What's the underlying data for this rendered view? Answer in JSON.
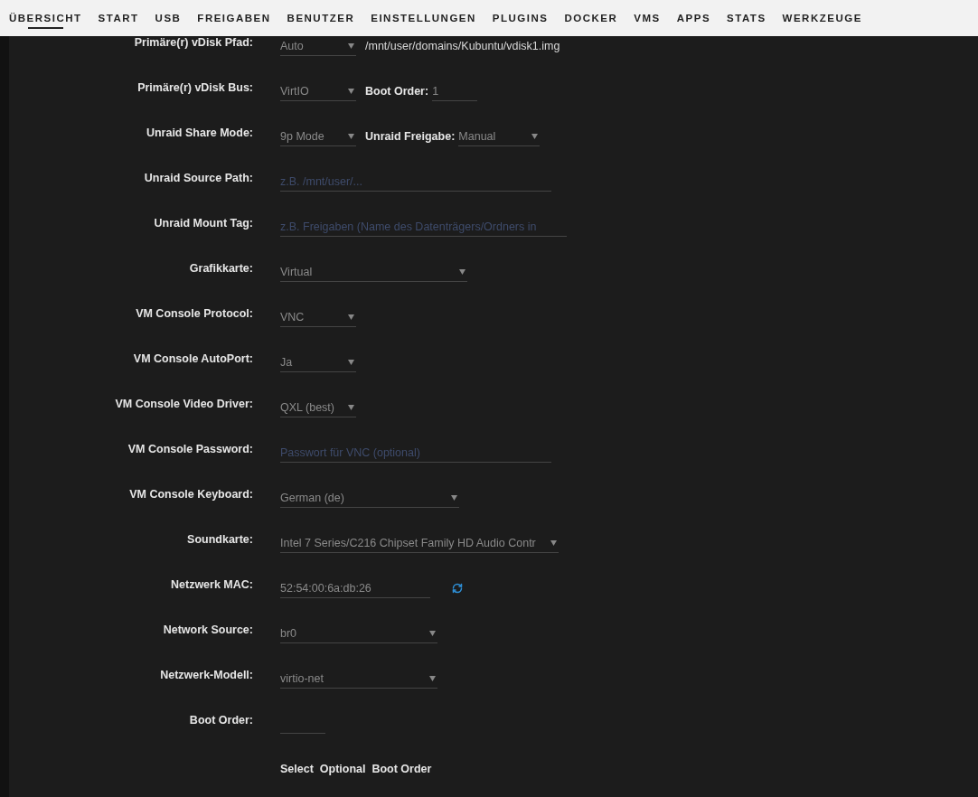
{
  "nav": [
    {
      "label": "ÜBERSICHT",
      "selected": true
    },
    {
      "label": "START",
      "selected": false
    },
    {
      "label": "USB",
      "selected": false
    },
    {
      "label": "FREIGABEN",
      "selected": false
    },
    {
      "label": "BENUTZER",
      "selected": false
    },
    {
      "label": "EINSTELLUNGEN",
      "selected": false
    },
    {
      "label": "PLUGINS",
      "selected": false
    },
    {
      "label": "DOCKER",
      "selected": false
    },
    {
      "label": "VMS",
      "selected": false
    },
    {
      "label": "APPS",
      "selected": false
    },
    {
      "label": "STATS",
      "selected": false
    },
    {
      "label": "WERKZEUGE",
      "selected": false
    }
  ],
  "rows": [
    {
      "label": "Primäre(r) vDisk Pfad:",
      "fields": [
        {
          "kind": "select",
          "value": "Auto"
        },
        {
          "kind": "text",
          "value": "/mnt/user/domains/Kubuntu/vdisk1.img"
        }
      ]
    },
    {
      "label": "Primäre(r) vDisk Bus:",
      "fields": [
        {
          "kind": "select",
          "value": "VirtIO"
        },
        {
          "kind": "label",
          "value": "Boot Order:"
        },
        {
          "kind": "input",
          "value": "1"
        }
      ]
    },
    {
      "label": "Unraid Share Mode:",
      "fields": [
        {
          "kind": "select",
          "value": "9p Mode"
        },
        {
          "kind": "label",
          "value": "Unraid Freigabe:"
        },
        {
          "kind": "select",
          "value": "Manual"
        }
      ]
    },
    {
      "label": "Unraid Source Path:",
      "fields": [
        {
          "kind": "input",
          "placeholder": "z.B. /mnt/user/..."
        }
      ]
    },
    {
      "label": "Unraid Mount Tag:",
      "fields": [
        {
          "kind": "input",
          "placeholder": "z.B. Freigaben (Name des Datenträgers/Ordners in"
        }
      ]
    },
    {
      "label": "Grafikkarte:",
      "fields": [
        {
          "kind": "select",
          "value": "Virtual"
        }
      ]
    },
    {
      "label": "VM Console Protocol:",
      "fields": [
        {
          "kind": "select",
          "value": "VNC"
        }
      ]
    },
    {
      "label": "VM Console AutoPort:",
      "fields": [
        {
          "kind": "select",
          "value": "Ja"
        }
      ]
    },
    {
      "label": "VM Console Video Driver:",
      "fields": [
        {
          "kind": "select",
          "value": "QXL (best)"
        }
      ]
    },
    {
      "label": "VM Console Password:",
      "fields": [
        {
          "kind": "input",
          "placeholder": "Passwort für VNC (optional)"
        }
      ]
    },
    {
      "label": "VM Console Keyboard:",
      "fields": [
        {
          "kind": "select",
          "value": "German (de)"
        }
      ]
    },
    {
      "label": "Soundkarte:",
      "fields": [
        {
          "kind": "select",
          "value": "Intel 7 Series/C216 Chipset Family HD Audio Contr"
        }
      ]
    },
    {
      "label": "Netzwerk MAC:",
      "fields": [
        {
          "kind": "input",
          "value": "52:54:00:6a:db:26"
        },
        {
          "kind": "refresh"
        }
      ]
    },
    {
      "label": "Network Source:",
      "fields": [
        {
          "kind": "select",
          "value": "br0"
        }
      ]
    },
    {
      "label": "Netzwerk-Modell:",
      "fields": [
        {
          "kind": "select",
          "value": "virtio-net"
        }
      ]
    },
    {
      "label": "Boot Order:",
      "fields": [
        {
          "kind": "input"
        }
      ]
    },
    {
      "fields": [
        {
          "kind": "note",
          "value": "Select  Optional  Boot Order"
        }
      ]
    }
  ]
}
